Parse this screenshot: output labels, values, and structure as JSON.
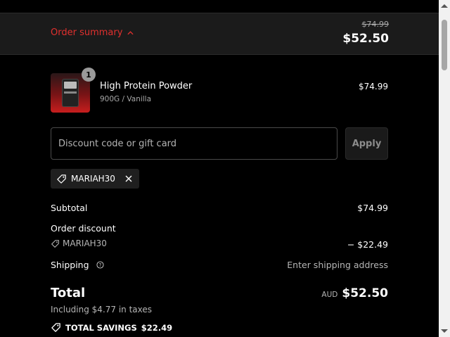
{
  "summary": {
    "toggle_label": "Order summary",
    "original_total": "$74.99",
    "total": "$52.50"
  },
  "product": {
    "quantity": "1",
    "name": "High Protein Powder",
    "variant": "900G / Vanilla",
    "price": "$74.99",
    "thumbnail_colors": {
      "top": "#2a1718",
      "bottom": "#c81e1e"
    }
  },
  "discount": {
    "placeholder": "Discount code or gift card",
    "value": "",
    "apply_label": "Apply",
    "applied_code": "MARIAH30"
  },
  "lines": {
    "subtotal_label": "Subtotal",
    "subtotal_value": "$74.99",
    "order_discount_label": "Order discount",
    "order_discount_code": "MARIAH30",
    "order_discount_value": "− $22.49",
    "shipping_label": "Shipping",
    "shipping_value": "Enter shipping address"
  },
  "total": {
    "label": "Total",
    "currency": "AUD",
    "amount": "$52.50",
    "taxes_note": "Including $4.77 in taxes",
    "savings_label": "TOTAL SAVINGS",
    "savings_value": "$22.49"
  },
  "colors": {
    "accent": "#e0302e",
    "background": "#000000",
    "summary_bar": "#1b1b1b"
  },
  "icons": {
    "toggle": "chevron-up-icon",
    "tag": "tag-icon",
    "remove": "close-icon",
    "help": "question-circle-icon"
  }
}
